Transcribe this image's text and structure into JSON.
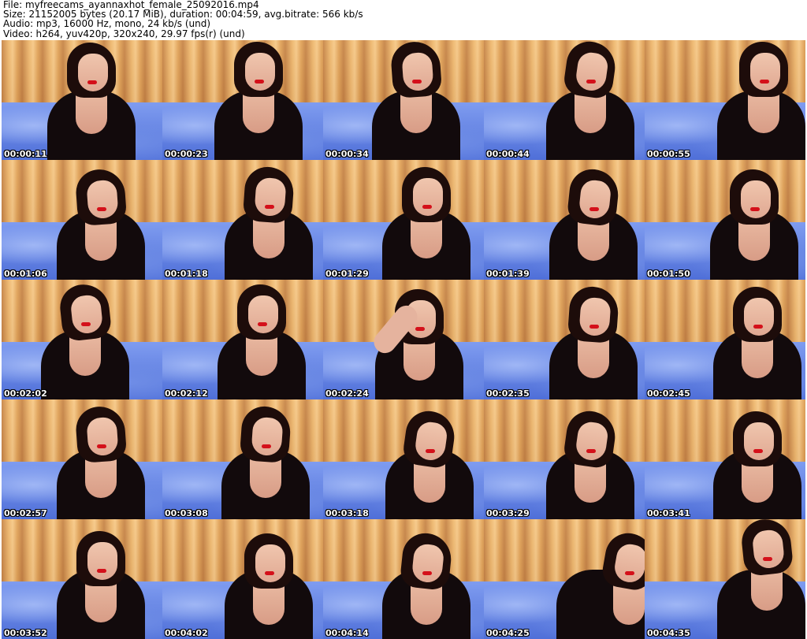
{
  "header": {
    "file_line": "File: myfreecams_ayannaxhot_female_25092016.mp4",
    "size_line": "Size: 21152005 bytes (20.17 MiB), duration: 00:04:59, avg.bitrate: 566 kb/s",
    "audio_line": "Audio: mp3, 16000 Hz, mono, 24 kb/s (und)",
    "video_line": "Video: h264, yuv420p, 320x240, 29.97 fps(r) (und)"
  },
  "thumbnails": [
    {
      "timestamp": "00:00:11"
    },
    {
      "timestamp": "00:00:23"
    },
    {
      "timestamp": "00:00:34"
    },
    {
      "timestamp": "00:00:44"
    },
    {
      "timestamp": "00:00:55"
    },
    {
      "timestamp": "00:01:06"
    },
    {
      "timestamp": "00:01:18"
    },
    {
      "timestamp": "00:01:29"
    },
    {
      "timestamp": "00:01:39"
    },
    {
      "timestamp": "00:01:50"
    },
    {
      "timestamp": "00:02:02"
    },
    {
      "timestamp": "00:02:12"
    },
    {
      "timestamp": "00:02:24"
    },
    {
      "timestamp": "00:02:35"
    },
    {
      "timestamp": "00:02:45"
    },
    {
      "timestamp": "00:02:57"
    },
    {
      "timestamp": "00:03:08"
    },
    {
      "timestamp": "00:03:18"
    },
    {
      "timestamp": "00:03:29"
    },
    {
      "timestamp": "00:03:41"
    },
    {
      "timestamp": "00:03:52"
    },
    {
      "timestamp": "00:04:02"
    },
    {
      "timestamp": "00:04:14"
    },
    {
      "timestamp": "00:04:25"
    },
    {
      "timestamp": "00:04:35"
    }
  ],
  "colors": {
    "background": "#ffffff",
    "timestamp_text": "#ffffff",
    "header_text": "#000000"
  }
}
